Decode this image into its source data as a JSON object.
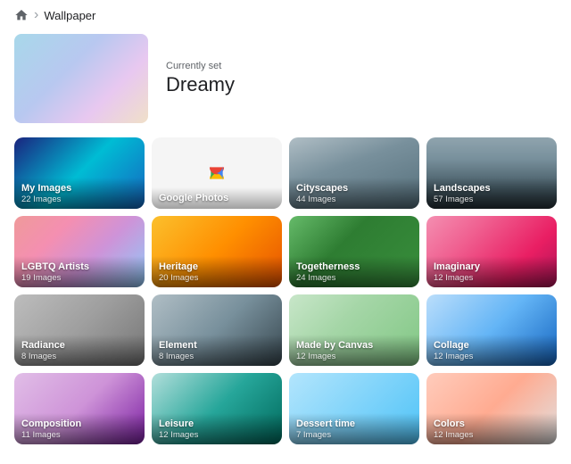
{
  "breadcrumb": {
    "home_icon": "🏠",
    "separator": "›",
    "current": "Wallpaper"
  },
  "hero": {
    "label": "Currently set",
    "title": "Dreamy"
  },
  "grid": {
    "items": [
      {
        "id": "my-images",
        "title": "My Images",
        "count": "22 Images",
        "bg": "bg-my-images"
      },
      {
        "id": "google-photos",
        "title": "Google Photos",
        "count": "",
        "bg": "bg-google-photos"
      },
      {
        "id": "cityscapes",
        "title": "Cityscapes",
        "count": "44 Images",
        "bg": "bg-cityscapes"
      },
      {
        "id": "landscapes",
        "title": "Landscapes",
        "count": "57 Images",
        "bg": "bg-landscapes"
      },
      {
        "id": "lgbtq-artists",
        "title": "LGBTQ Artists",
        "count": "19 Images",
        "bg": "bg-lgbtq"
      },
      {
        "id": "heritage",
        "title": "Heritage",
        "count": "20 Images",
        "bg": "bg-heritage"
      },
      {
        "id": "togetherness",
        "title": "Togetherness",
        "count": "24 Images",
        "bg": "bg-togetherness"
      },
      {
        "id": "imaginary",
        "title": "Imaginary",
        "count": "12 Images",
        "bg": "bg-imaginary"
      },
      {
        "id": "radiance",
        "title": "Radiance",
        "count": "8 Images",
        "bg": "bg-radiance"
      },
      {
        "id": "element",
        "title": "Element",
        "count": "8 Images",
        "bg": "bg-element"
      },
      {
        "id": "made-by-canvas",
        "title": "Made by Canvas",
        "count": "12 Images",
        "bg": "bg-made-by-canvas"
      },
      {
        "id": "collage",
        "title": "Collage",
        "count": "12 Images",
        "bg": "bg-collage"
      },
      {
        "id": "composition",
        "title": "Composition",
        "count": "11 Images",
        "bg": "bg-composition"
      },
      {
        "id": "leisure",
        "title": "Leisure",
        "count": "12 Images",
        "bg": "bg-leisure"
      },
      {
        "id": "dessert-time",
        "title": "Dessert time",
        "count": "7 Images",
        "bg": "bg-dessert-time"
      },
      {
        "id": "colors",
        "title": "Colors",
        "count": "12 Images",
        "bg": "bg-colors"
      }
    ]
  }
}
